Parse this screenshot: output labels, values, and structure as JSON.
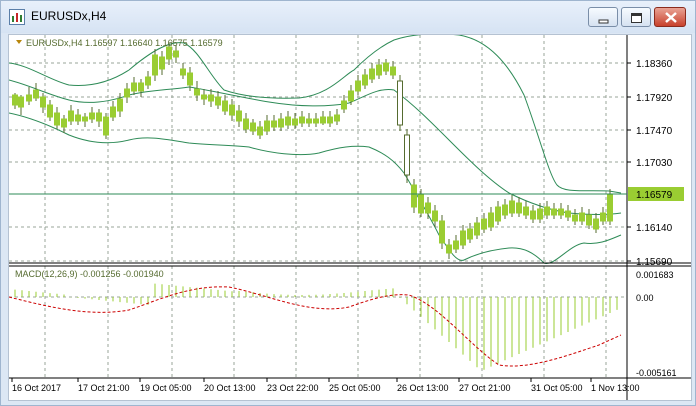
{
  "window": {
    "title": "EURUSDx,H4"
  },
  "header": {
    "symbol_info": "EURUSDx,H4  1.16597 1.16640 1.16575 1.16579"
  },
  "macd": {
    "info": "MACD(12,26,9) -0.001256 -0.001940"
  },
  "colors": {
    "grid": "#9aa59a",
    "bull_candle": "#9acd32",
    "bollinger": "#2e8b57",
    "macd_signal": "#cc0000",
    "macd_hist": "#9acd32",
    "price_line": "#2e8b57"
  },
  "price_axis": {
    "labels": [
      "1.18360",
      "1.17920",
      "1.17470",
      "1.17030",
      "1.16140",
      "1.15690"
    ],
    "current_price": "1.16579"
  },
  "macd_axis": {
    "labels": [
      "0.001683",
      "0.00",
      "-0.005161"
    ]
  },
  "time_axis": {
    "labels": [
      "16 Oct 2017",
      "17 Oct 21:00",
      "19 Oct 05:00",
      "20 Oct 13:00",
      "23 Oct 22:00",
      "25 Oct 05:00",
      "26 Oct 13:00",
      "27 Oct 21:00",
      "31 Oct 05:00",
      "1 Nov 13:00"
    ]
  }
}
